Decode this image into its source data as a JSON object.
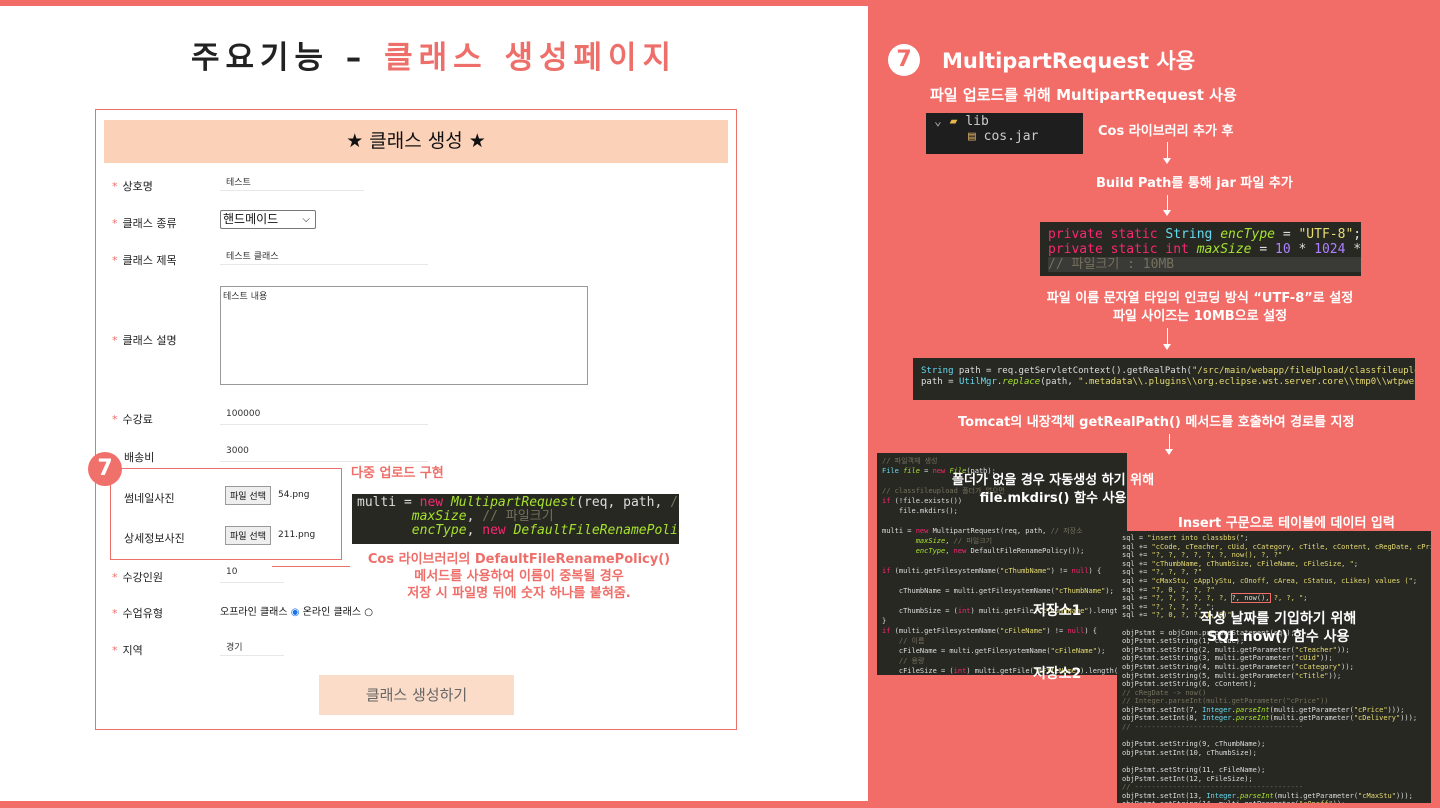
{
  "slide": {
    "title_prefix": "주요기능 – ",
    "title_accent": "클래스 생성페이지"
  },
  "form": {
    "header": "★ 클래스 생성 ★",
    "fields": [
      {
        "label": "상호명",
        "value": "테스트"
      },
      {
        "label": "클래스 종류",
        "value": "핸드메이드"
      },
      {
        "label": "클래스 제목",
        "value": "테스트 클래스"
      },
      {
        "label": "클래스 설명",
        "value": "테스트 내용"
      },
      {
        "label": "수강료",
        "value": "100000"
      },
      {
        "label": "배송비",
        "value": "3000"
      },
      {
        "label": "썸네일사진",
        "value": "54.png"
      },
      {
        "label": "상세정보사진",
        "value": "211.png"
      },
      {
        "label": "수강인원",
        "value": "10"
      },
      {
        "label": "수업유형",
        "value": ""
      },
      {
        "label": "지역",
        "value": "경기"
      }
    ],
    "file_button": "파일 선택",
    "radio_offline": "오프라인 클래스",
    "radio_online": "온라인 클래스",
    "submit": "클래스 생성하기"
  },
  "left_notes": {
    "badge": "7",
    "multi_upload": "다중 업로드 구현",
    "policy_l1": "Cos 라이브러리의 DefaultFileRenamePolicy()",
    "policy_l2": "메서드를 사용하여 이름이 중복될 경우",
    "policy_l3": "저장 시 파일명 뒤에 숫자 하나를 붙혀줌."
  },
  "right": {
    "badge": "7",
    "heading": "MultipartRequest 사용",
    "sub": "파일 업로드를 위해 MultipartRequest 사용",
    "lib_folder": "lib",
    "lib_file": "cos.jar",
    "cos_note": "Cos 라이브러리 추가 후",
    "build_path": "Build Path를 통해 jar 파일 추가",
    "enc_l1": "파일 이름 문자열 타입의 인코딩 방식 “UTF-8”로 설정",
    "enc_l2": "파일 사이즈는 10MB으로 설정",
    "tomcat": "Tomcat의 내장객체 getRealPath() 메서드를 호출하여 경로를 지정",
    "mkdir_l1": "폴더가 없을 경우 자동생성 하기 위해",
    "mkdir_l2": "file.mkdirs() 함수 사용",
    "insert": "Insert 구문으로 테이블에 데이터 입력",
    "store1": "저장소1",
    "store2": "저장소2",
    "now_l1": "작성 날짜를 기입하기 위해",
    "now_l2": "SQL now() 함수 사용"
  },
  "colors": {
    "accent": "#f26d68",
    "header_bg": "#fbd1b8",
    "code_bg": "#272822"
  }
}
